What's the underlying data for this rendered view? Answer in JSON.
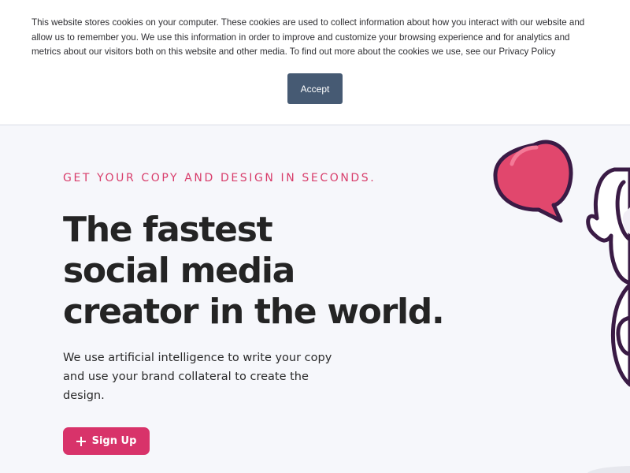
{
  "cookie_banner": {
    "message": "This website stores cookies on your computer. These cookies are used to collect information about how you interact with our website and allow us to remember you. We use this information in order to improve and customize your browsing experience and for analytics and metrics about our visitors both on this website and other media. To find out more about the cookies we use, see our ",
    "policy_link": "Privacy Policy",
    "accept_label": "Accept"
  },
  "hero": {
    "eyebrow": "GET YOUR COPY AND DESIGN IN SECONDS.",
    "headline": [
      "The fastest",
      "social media",
      "creator in the world."
    ],
    "subcopy": "We use artificial intelligence to write your copy and use your brand collateral to create the design.",
    "signup_label": "Sign Up"
  },
  "icons": {
    "signup": "plus-icon",
    "illustration_bubble": "speech-bubble-icon"
  },
  "colors": {
    "accent": "#d8336a",
    "accept_button": "#465a73",
    "headline": "#242424",
    "background": "#f6f7fb",
    "illustration_outline": "#3a1b45"
  }
}
